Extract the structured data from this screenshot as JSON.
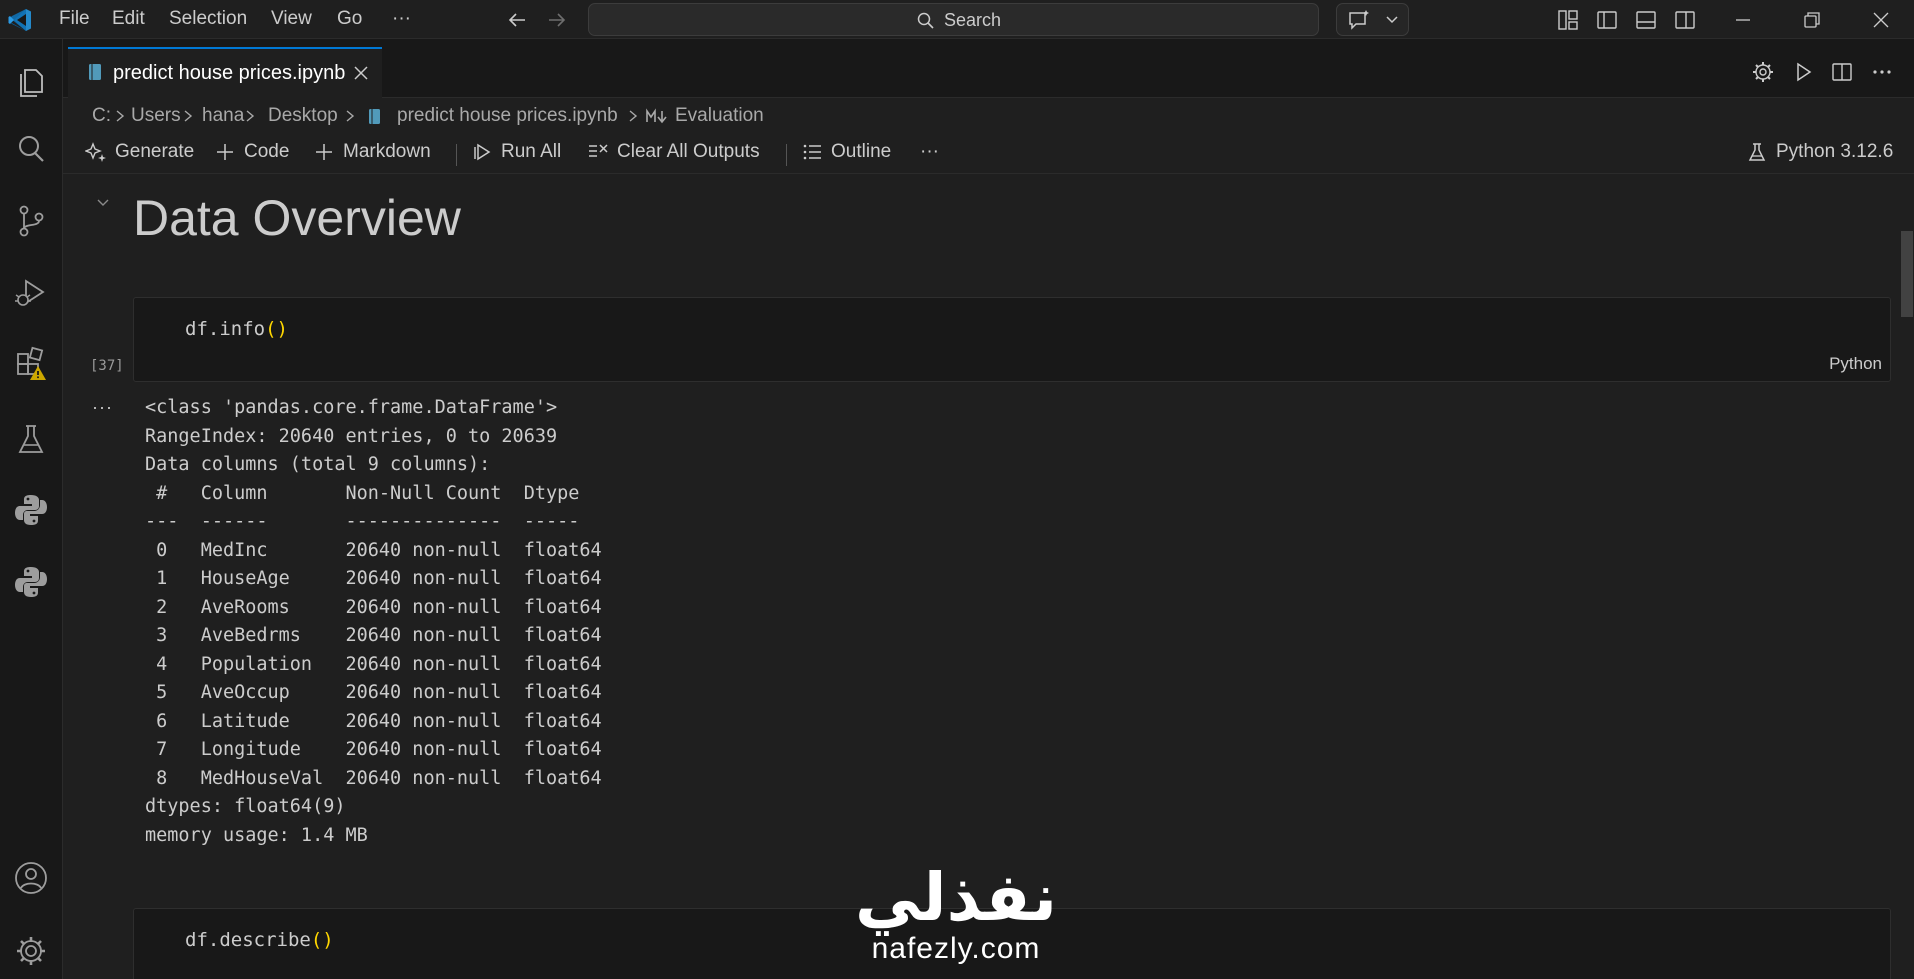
{
  "menu": [
    "File",
    "Edit",
    "Selection",
    "View",
    "Go",
    "···"
  ],
  "search": {
    "label": "Search"
  },
  "tab": {
    "label": "predict house prices.ipynb"
  },
  "breadcrumb": [
    "C:",
    "Users",
    "hana",
    "Desktop",
    "predict house prices.ipynb",
    "Evaluation"
  ],
  "toolbar": {
    "generate": "Generate",
    "code": "Code",
    "markdown": "Markdown",
    "run_all": "Run All",
    "clear_outputs": "Clear All Outputs",
    "outline": "Outline",
    "more": "···",
    "kernel": "Python 3.12.6"
  },
  "notebook": {
    "heading": "Data Overview",
    "cells": [
      {
        "code_fn": "df.info",
        "code_paren": "()",
        "exec_count": "[37]",
        "language": "Python"
      },
      {
        "code_fn": "df.describe",
        "code_paren": "()"
      }
    ],
    "output_dots": "···",
    "output": "<class 'pandas.core.frame.DataFrame'>\nRangeIndex: 20640 entries, 0 to 20639\nData columns (total 9 columns):\n #   Column       Non-Null Count  Dtype  \n---  ------       --------------  -----  \n 0   MedInc       20640 non-null  float64\n 1   HouseAge     20640 non-null  float64\n 2   AveRooms     20640 non-null  float64\n 3   AveBedrms    20640 non-null  float64\n 4   Population   20640 non-null  float64\n 5   AveOccup     20640 non-null  float64\n 6   Latitude     20640 non-null  float64\n 7   Longitude    20640 non-null  float64\n 8   MedHouseVal  20640 non-null  float64\ndtypes: float64(9)\nmemory usage: 1.4 MB"
  },
  "watermark": {
    "arabic": "نفذلي",
    "latin": "nafezly.com"
  },
  "colors": {
    "accent": "#0078d4",
    "bracket": "#ffd700",
    "warning": "#cca700"
  }
}
